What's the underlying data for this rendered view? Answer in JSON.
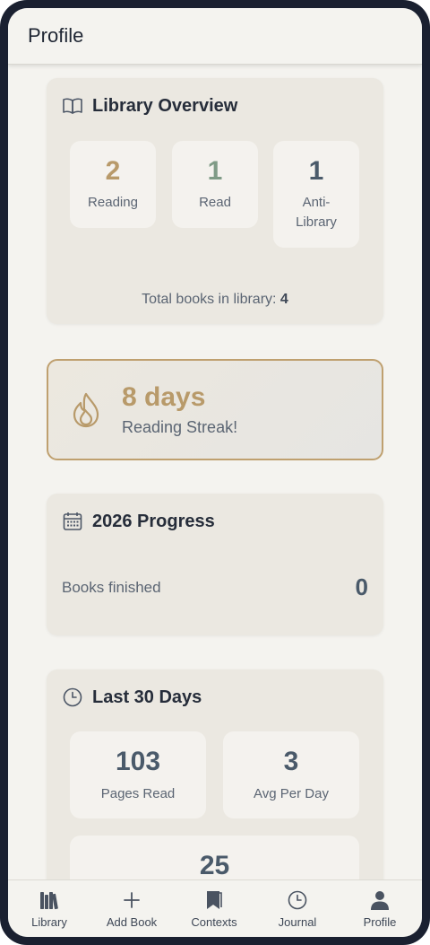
{
  "header": {
    "title": "Profile"
  },
  "library_overview": {
    "title": "Library Overview",
    "icon": "book-open-icon",
    "stats": [
      {
        "value": "2",
        "label": "Reading",
        "color": "#b89a6a"
      },
      {
        "value": "1",
        "label": "Read",
        "color": "#7f9b86"
      },
      {
        "value": "1",
        "label": "Anti-\nLibrary",
        "color": "#4a5a6a"
      }
    ],
    "total_label": "Total books in library: ",
    "total_value": "4"
  },
  "streak": {
    "icon": "flame-icon",
    "days": "8 days",
    "label": "Reading Streak!",
    "accent": "#b89a6a"
  },
  "progress": {
    "title": "2026 Progress",
    "icon": "calendar-icon",
    "books_finished_label": "Books finished",
    "books_finished_value": "0"
  },
  "last30": {
    "title": "Last 30 Days",
    "icon": "clock-icon",
    "pages_read_value": "103",
    "pages_read_label": "Pages Read",
    "avg_value": "3",
    "avg_label": "Avg Per Day",
    "third_value": "25"
  },
  "nav": [
    {
      "label": "Library",
      "icon": "library-icon"
    },
    {
      "label": "Add Book",
      "icon": "plus-icon"
    },
    {
      "label": "Contexts",
      "icon": "bookmark-icon"
    },
    {
      "label": "Journal",
      "icon": "clock-icon"
    },
    {
      "label": "Profile",
      "icon": "user-icon"
    }
  ]
}
